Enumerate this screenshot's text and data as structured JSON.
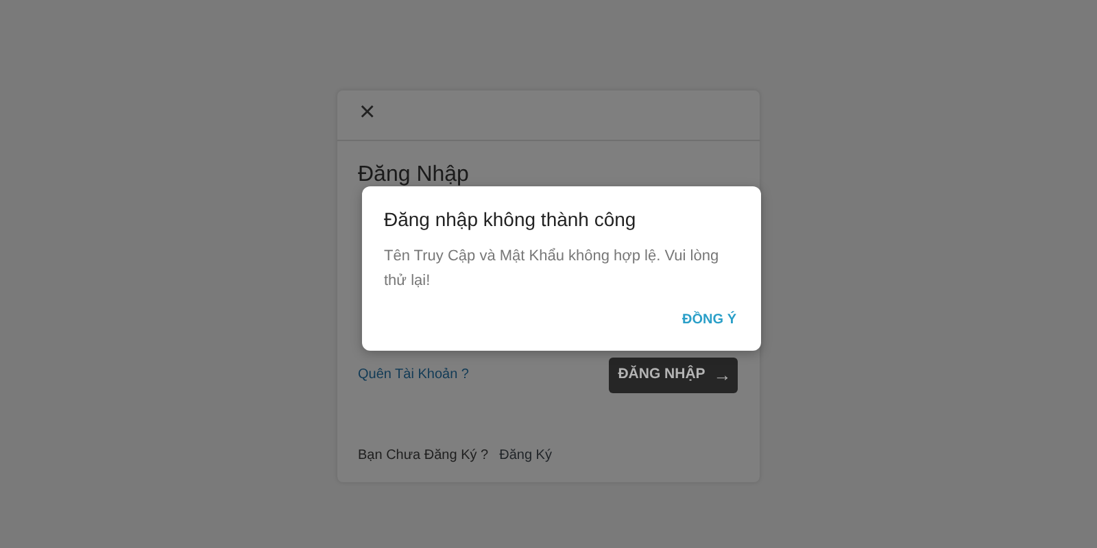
{
  "login_card": {
    "close": "×",
    "title": "Đăng Nhập",
    "forgot_link": "Quên Tài Khoản ?",
    "login_button": "ĐĂNG NHẬP",
    "arrow": "→",
    "signup_prompt": "Bạn Chưa Đăng Ký ?",
    "signup_link": "Đăng Ký"
  },
  "alert_dialog": {
    "title": "Đăng nhập không thành công",
    "message": "Tên Truy Cập và Mật Khẩu không hợp lệ. Vui lòng thử lại!",
    "ok_button": "ĐỒNG Ý"
  }
}
